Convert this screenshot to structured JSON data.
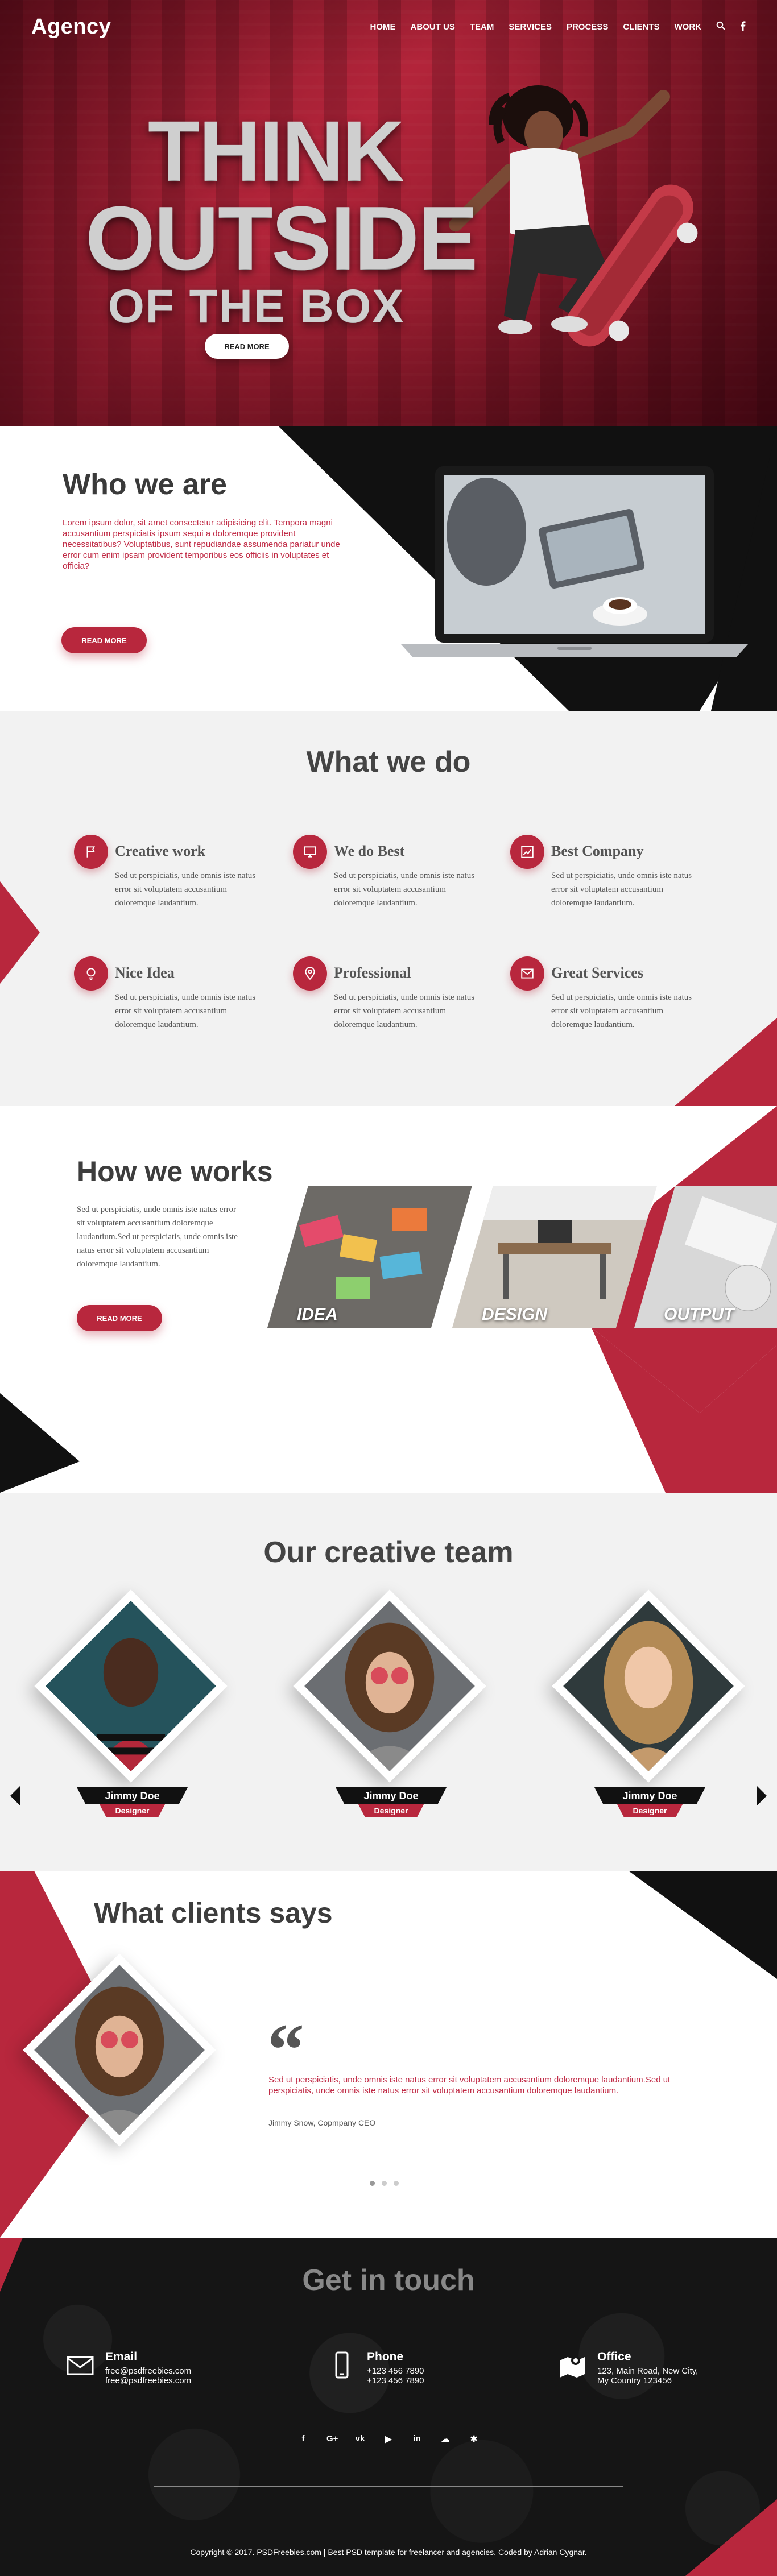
{
  "header": {
    "logo": "Agency",
    "nav": [
      "HOME",
      "ABOUT US",
      "TEAM",
      "SERVICES",
      "PROCESS",
      "CLIENTS",
      "WORK"
    ],
    "icons": [
      "search-icon",
      "facebook-icon"
    ]
  },
  "hero": {
    "line1": "THINK",
    "line2": "OUTSIDE",
    "line3": "OF THE BOX",
    "button": "READ MORE"
  },
  "who": {
    "title": "Who we are",
    "text": "Lorem ipsum dolor, sit amet consectetur adipisicing elit. Tempora magni accusantium perspiciatis ipsum sequi a doloremque provident necessitatibus? Voluptatibus, sunt repudiandae assumenda pariatur unde error cum enim ipsam provident temporibus eos officiis in voluptates et officia?",
    "button": "READ MORE"
  },
  "what": {
    "title": "What we do",
    "services": [
      {
        "title": "Creative work",
        "text": "Sed ut perspiciatis, unde omnis iste natus error sit voluptatem accusantium doloremque laudantium.",
        "icon": "flag-icon"
      },
      {
        "title": "We do Best",
        "text": "Sed ut perspiciatis, unde omnis iste natus error sit voluptatem accusantium doloremque laudantium.",
        "icon": "monitor-icon"
      },
      {
        "title": "Best Company",
        "text": "Sed ut perspiciatis, unde omnis iste natus error sit voluptatem accusantium doloremque laudantium.",
        "icon": "chart-icon"
      },
      {
        "title": "Nice Idea",
        "text": "Sed ut perspiciatis, unde omnis iste natus error sit voluptatem accusantium doloremque laudantium.",
        "icon": "idea-icon"
      },
      {
        "title": "Professional",
        "text": "Sed ut perspiciatis, unde omnis iste natus error sit voluptatem accusantium doloremque laudantium.",
        "icon": "location-icon"
      },
      {
        "title": "Great Services",
        "text": "Sed ut perspiciatis, unde omnis iste natus error sit voluptatem accusantium doloremque laudantium.",
        "icon": "mail-icon"
      }
    ]
  },
  "how": {
    "title": "How we works",
    "text": "Sed ut perspiciatis, unde omnis iste natus error sit voluptatem accusantium doloremque laudantium.Sed ut perspiciatis, unde omnis iste natus error sit voluptatem accusantium doloremque laudantium.",
    "button": "READ MORE",
    "steps": [
      "IDEA",
      "DESIGN",
      "OUTPUT"
    ]
  },
  "team": {
    "title": "Our creative team",
    "members": [
      {
        "name": "Jimmy Doe",
        "role": "Designer"
      },
      {
        "name": "Jimmy Doe",
        "role": "Designer"
      },
      {
        "name": "Jimmy Doe",
        "role": "Designer"
      }
    ]
  },
  "clients": {
    "title": "What clients says",
    "quote_mark": "“",
    "text": "Sed ut perspiciatis, unde omnis iste natus error sit voluptatem accusantium doloremque laudantium.Sed ut perspiciatis, unde omnis iste natus error sit voluptatem accusantium doloremque laudantium.",
    "author": "Jimmy Snow, Copmpany CEO"
  },
  "contact": {
    "title": "Get in touch",
    "email": {
      "label": "Email",
      "line1": "free@psdfreebies.com",
      "line2": "free@psdfreebies.com"
    },
    "phone": {
      "label": "Phone",
      "line1": "+123 456 7890",
      "line2": "+123 456 7890"
    },
    "office": {
      "label": "Office",
      "line1": "123, Main Road, New City,",
      "line2": "My Country 123456"
    },
    "socials": [
      "f",
      "G+",
      "vk",
      "▶",
      "in",
      "☁",
      "✱"
    ]
  },
  "footer": {
    "copyright": "Copyright © 2017. PSDFreebies.com | Best PSD template for freelancer and agencies. Coded by Adrian Cygnar."
  },
  "colors": {
    "accent": "#b8273d",
    "dark": "#111111",
    "light_bg": "#f2f2f2"
  }
}
